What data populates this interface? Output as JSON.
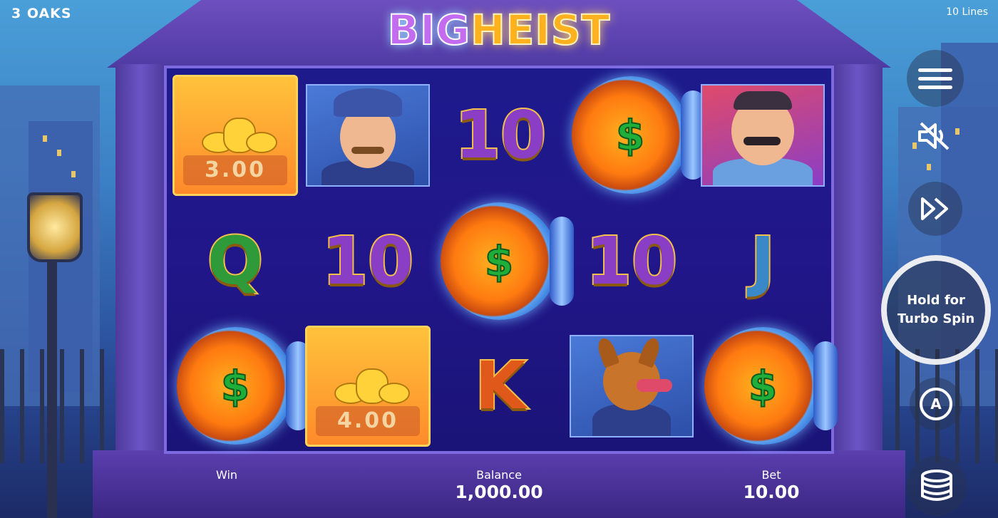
{
  "brand": "3 OAKS",
  "title_part1": "BIG",
  "title_part2": "HEIST",
  "lines_label": "10 Lines",
  "grid": {
    "coin1_value": "3.00",
    "coin2_value": "4.00",
    "symbols": {
      "r0c2": "10",
      "r1c0": "Q",
      "r1c1": "10",
      "r1c3": "10",
      "r1c4": "J",
      "r2c2": "K",
      "vault_symbol": "$"
    }
  },
  "spin_button": {
    "line1": "Hold for",
    "line2": "Turbo Spin"
  },
  "autoplay_label": "A",
  "footer": {
    "win_label": "Win",
    "balance_label": "Balance",
    "balance_value": "1,000.00",
    "bet_label": "Bet",
    "bet_value": "10.00"
  },
  "colors": {
    "purple_letter": "#8a3ec6",
    "green_letter": "#2e9a3a",
    "blue_letter": "#3a88c8",
    "orange_letter": "#e0581a"
  },
  "icons": [
    "menu-icon",
    "sound-muted-icon",
    "fast-forward-icon",
    "autoplay-icon",
    "coins-stack-icon"
  ]
}
